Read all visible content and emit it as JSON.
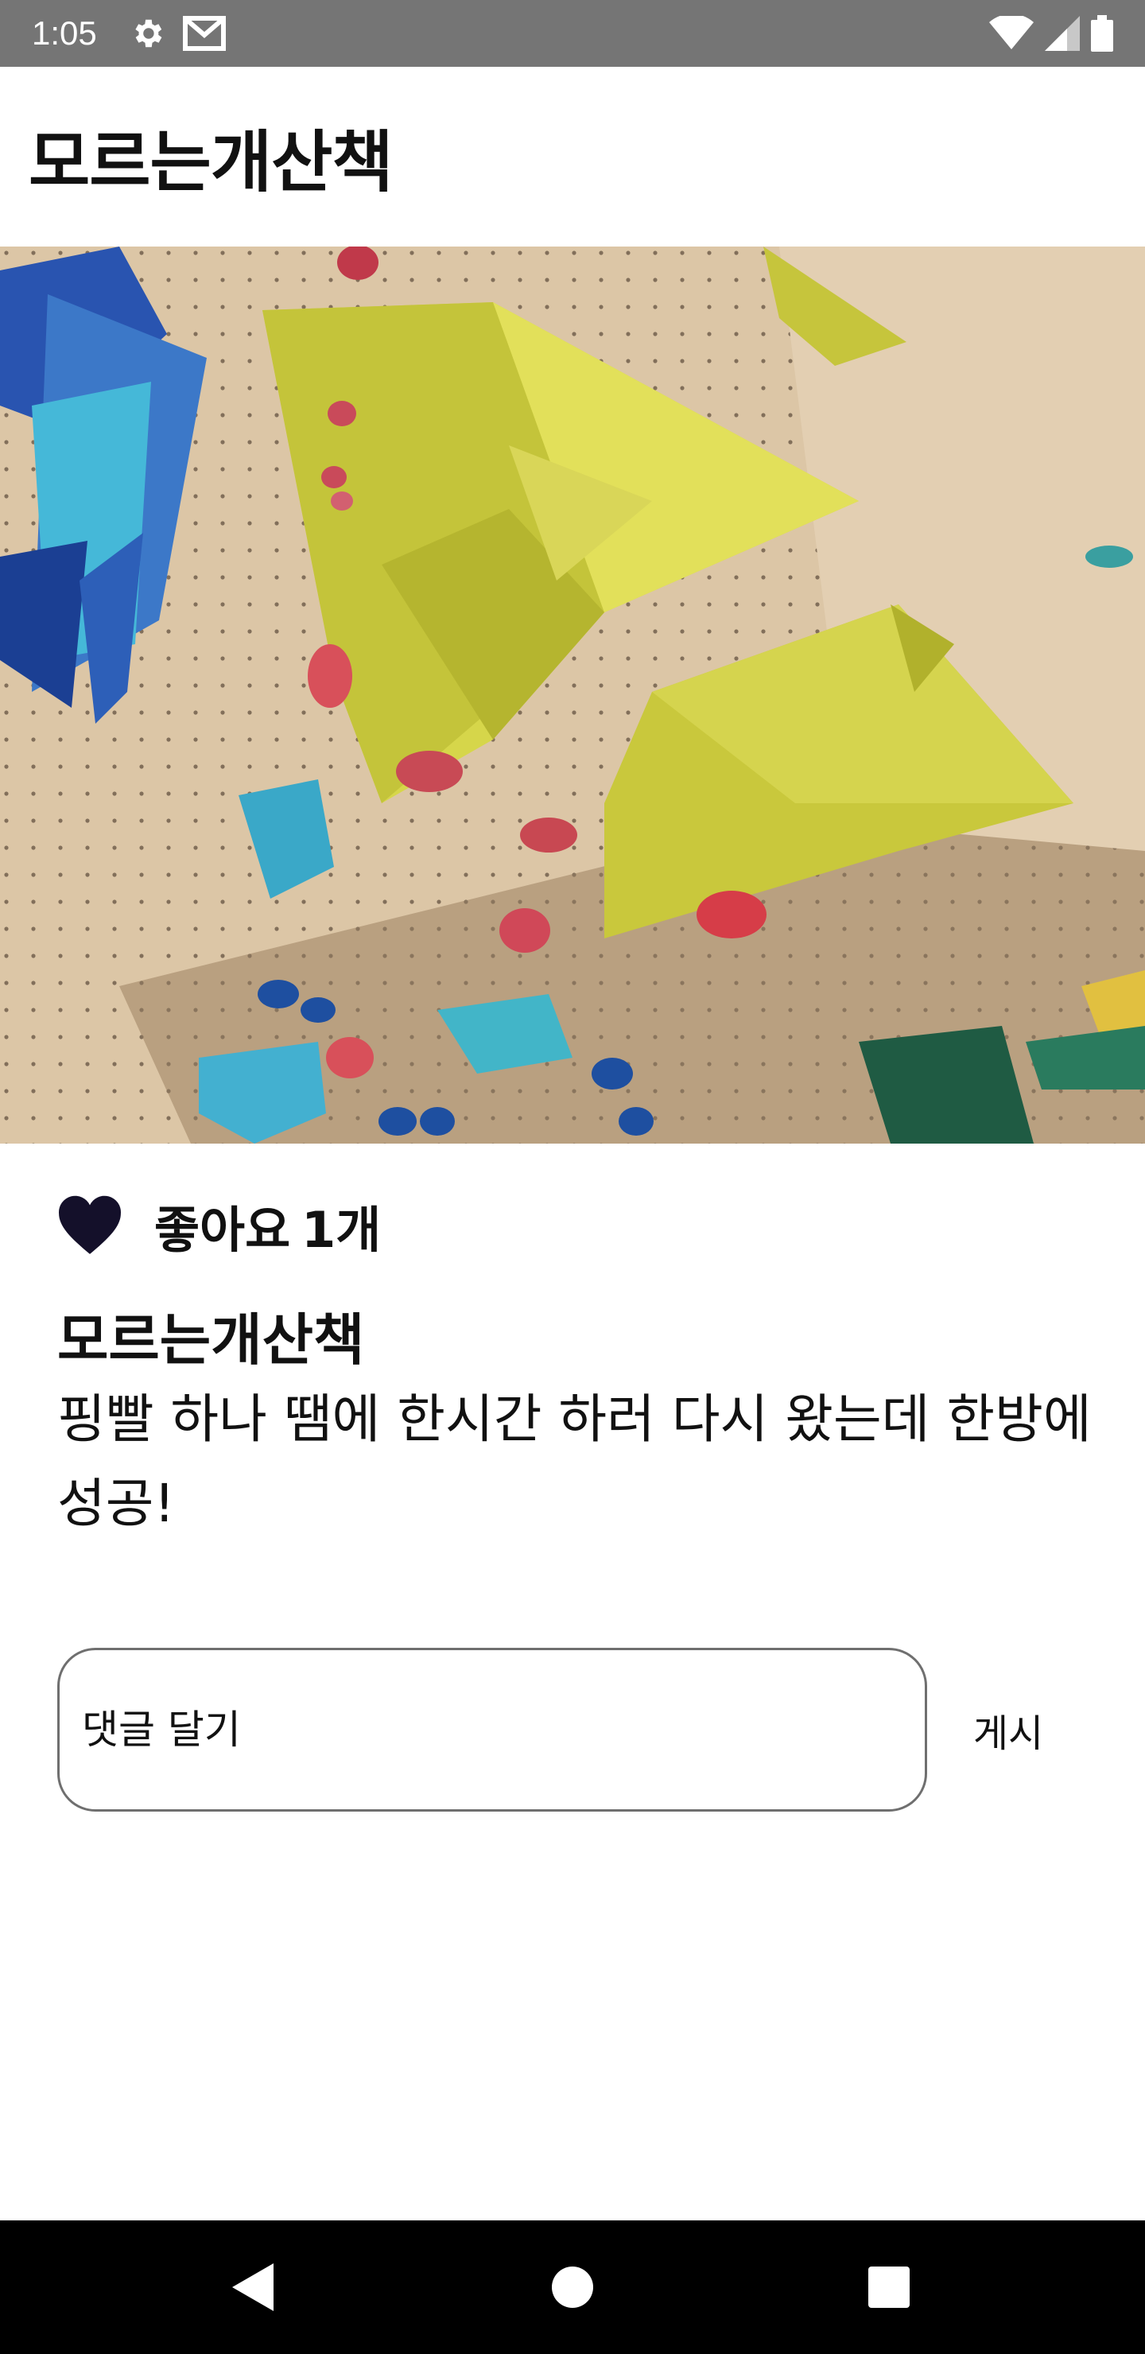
{
  "status_bar": {
    "time": "1:05",
    "icons": [
      "settings-icon",
      "gmail-icon",
      "wifi-icon",
      "cellular-icon",
      "battery-icon"
    ]
  },
  "app_bar": {
    "title": "모르는개산책"
  },
  "post": {
    "image_alt": "climbing-wall-photo",
    "likes": {
      "icon": "heart-icon",
      "label": "좋아요",
      "count": "1개"
    },
    "caption": {
      "username": "모르는개산책",
      "text": "핑빨 하나 땜에 한시간 하러 다시 왔는데 한방에 성공!"
    }
  },
  "comment": {
    "placeholder": "댓글 달기",
    "post_label": "게시"
  },
  "navigation": {
    "buttons": [
      "back-icon",
      "home-icon",
      "recents-icon"
    ]
  },
  "colors": {
    "status_bar": "#757575",
    "nav_bar": "#000000",
    "heart": "#14102a",
    "wall_yellow": "#d6d64a",
    "wall_blue": "#2d5fb8"
  }
}
